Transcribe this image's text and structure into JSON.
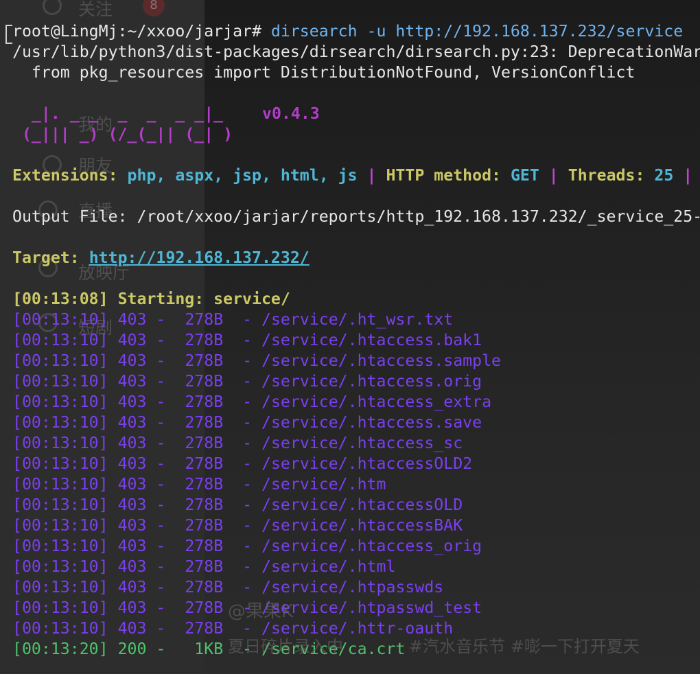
{
  "background_ui": {
    "items": [
      {
        "label": "关注",
        "badge": "8"
      },
      {
        "label": "我的"
      },
      {
        "label": "朋友"
      },
      {
        "label": "直播"
      },
      {
        "label": "放映厅"
      },
      {
        "label": "短剧"
      }
    ]
  },
  "terminal": {
    "prompt": "root@LingMj:~/xxoo/jarjar# ",
    "command": "dirsearch -u http://192.168.137.232/service",
    "warning_path": "/usr/lib/python3/dist-packages/dirsearch/dirsearch.py:23: DeprecationWarn",
    "warning_import": "  from pkg_resources import DistributionNotFound, VersionConflict",
    "art_line1": "  _|. _ _  _  _  _ _|_",
    "art_line2": " (_||| _) (/_(_|| (_| )",
    "version": "v0.4.3",
    "extensions_label": "Extensions: ",
    "extensions_value": "php, aspx, jsp, html, js",
    "sep1": " | ",
    "method_label": "HTTP method: ",
    "method_value": "GET",
    "sep2": " | ",
    "threads_label": "Threads: ",
    "threads_value": "25",
    "sep3": " |",
    "output_file": "Output File: /root/xxoo/jarjar/reports/http_192.168.137.232/_service_25-",
    "target_label": "Target: ",
    "target_value": "http://192.168.137.232/",
    "starting_time": "[00:13:08]",
    "starting_text": " Starting: service/",
    "results": [
      {
        "time": "[00:13:10]",
        "status": "403",
        "size": "278B",
        "path": "/service/.ht_wsr.txt"
      },
      {
        "time": "[00:13:10]",
        "status": "403",
        "size": "278B",
        "path": "/service/.htaccess.bak1"
      },
      {
        "time": "[00:13:10]",
        "status": "403",
        "size": "278B",
        "path": "/service/.htaccess.sample"
      },
      {
        "time": "[00:13:10]",
        "status": "403",
        "size": "278B",
        "path": "/service/.htaccess.orig"
      },
      {
        "time": "[00:13:10]",
        "status": "403",
        "size": "278B",
        "path": "/service/.htaccess_extra"
      },
      {
        "time": "[00:13:10]",
        "status": "403",
        "size": "278B",
        "path": "/service/.htaccess.save"
      },
      {
        "time": "[00:13:10]",
        "status": "403",
        "size": "278B",
        "path": "/service/.htaccess_sc"
      },
      {
        "time": "[00:13:10]",
        "status": "403",
        "size": "278B",
        "path": "/service/.htaccessOLD2"
      },
      {
        "time": "[00:13:10]",
        "status": "403",
        "size": "278B",
        "path": "/service/.htm"
      },
      {
        "time": "[00:13:10]",
        "status": "403",
        "size": "278B",
        "path": "/service/.htaccessOLD"
      },
      {
        "time": "[00:13:10]",
        "status": "403",
        "size": "278B",
        "path": "/service/.htaccessBAK"
      },
      {
        "time": "[00:13:10]",
        "status": "403",
        "size": "278B",
        "path": "/service/.htaccess_orig"
      },
      {
        "time": "[00:13:10]",
        "status": "403",
        "size": "278B",
        "path": "/service/.html"
      },
      {
        "time": "[00:13:10]",
        "status": "403",
        "size": "278B",
        "path": "/service/.htpasswds"
      },
      {
        "time": "[00:13:10]",
        "status": "403",
        "size": "278B",
        "path": "/service/.htpasswd_test"
      },
      {
        "time": "[00:13:10]",
        "status": "403",
        "size": "278B",
        "path": "/service/.httr-oauth"
      },
      {
        "time": "[00:13:20]",
        "status": "200",
        "size": " 1KB",
        "path": "/service/ca.crt"
      }
    ]
  },
  "watermark": {
    "author": "@果果K",
    "caption": "夏日碎片录入中",
    "tags": "#汽水音乐节 #嘭一下打开夏天"
  },
  "colors": {
    "yellow": "#cbc866",
    "cyan": "#4fb7d6",
    "magenta": "#c242d4",
    "purple": "#7b3ff0",
    "green": "#4ec46a",
    "command_blue": "#6fb3ef"
  }
}
